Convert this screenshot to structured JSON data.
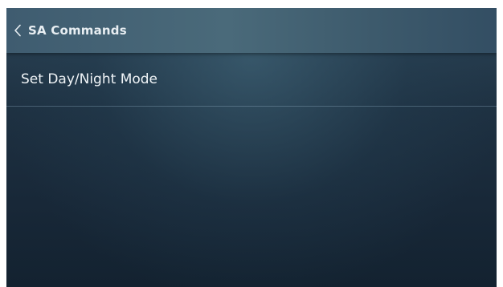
{
  "header": {
    "title": "SA Commands",
    "back_icon": "chevron-left-icon"
  },
  "list": {
    "items": [
      {
        "label": "Set Day/Night Mode"
      }
    ]
  },
  "colors": {
    "header_bg": "#44636f",
    "body_bg": "#1b2d3c",
    "text": "#f0f4f7",
    "divider": "#6f8ea3"
  }
}
